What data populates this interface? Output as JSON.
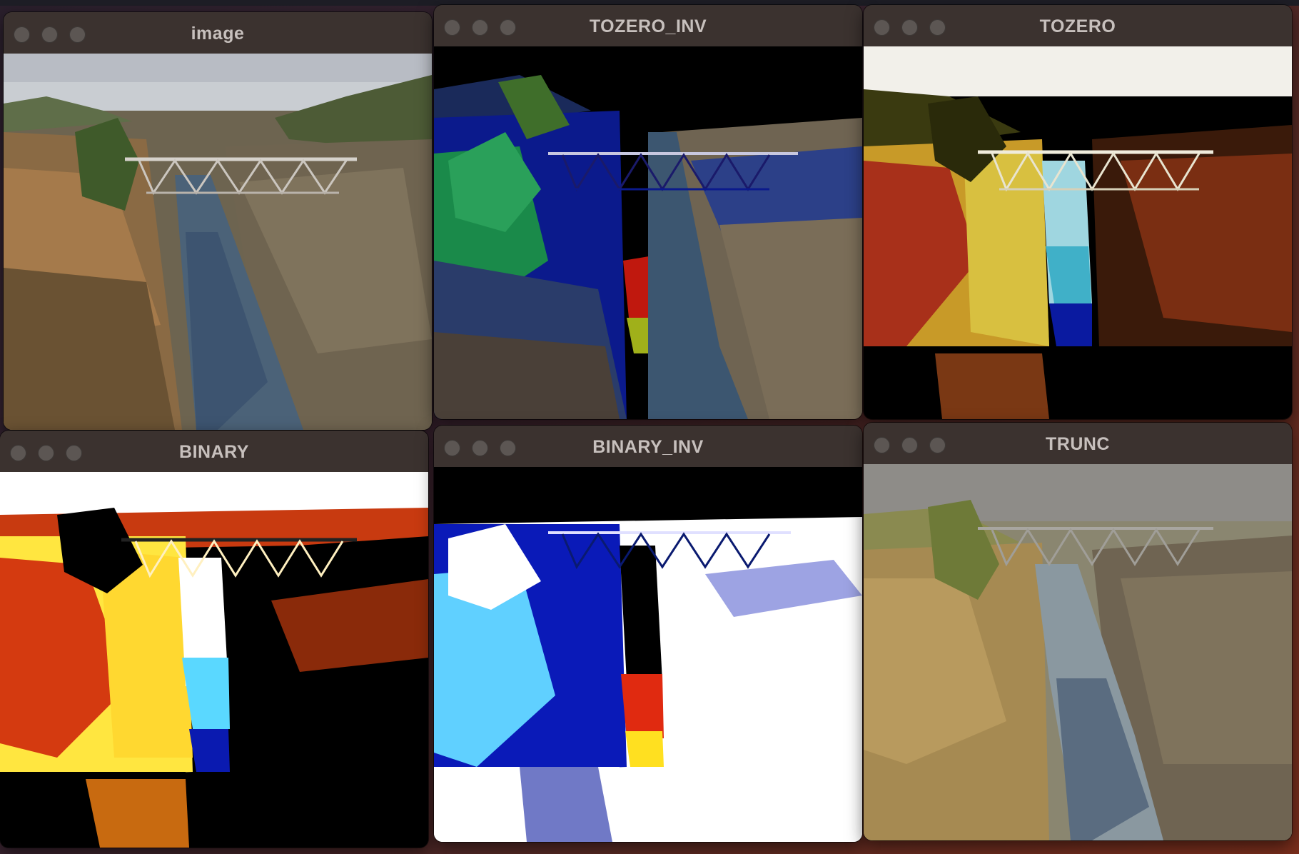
{
  "windows": [
    {
      "title": "image",
      "controls": [
        "close-button",
        "minimize-button",
        "zoom-button"
      ]
    },
    {
      "title": "TOZERO_INV",
      "controls": [
        "close-button",
        "minimize-button",
        "zoom-button"
      ]
    },
    {
      "title": "TOZERO",
      "controls": [
        "close-button",
        "minimize-button",
        "zoom-button"
      ]
    },
    {
      "title": "BINARY",
      "controls": [
        "close-button",
        "minimize-button",
        "zoom-button"
      ]
    },
    {
      "title": "BINARY_INV",
      "controls": [
        "close-button",
        "minimize-button",
        "zoom-button"
      ]
    },
    {
      "title": "TRUNC",
      "controls": [
        "close-button",
        "minimize-button",
        "zoom-button"
      ]
    }
  ],
  "icons": {
    "close": "circle-icon",
    "minimize": "circle-icon",
    "zoom": "circle-icon"
  },
  "colors": {
    "titlebar": "#3b322f",
    "traffic_light_inactive": "#5c5653",
    "title_text": "#c7c0bd"
  }
}
